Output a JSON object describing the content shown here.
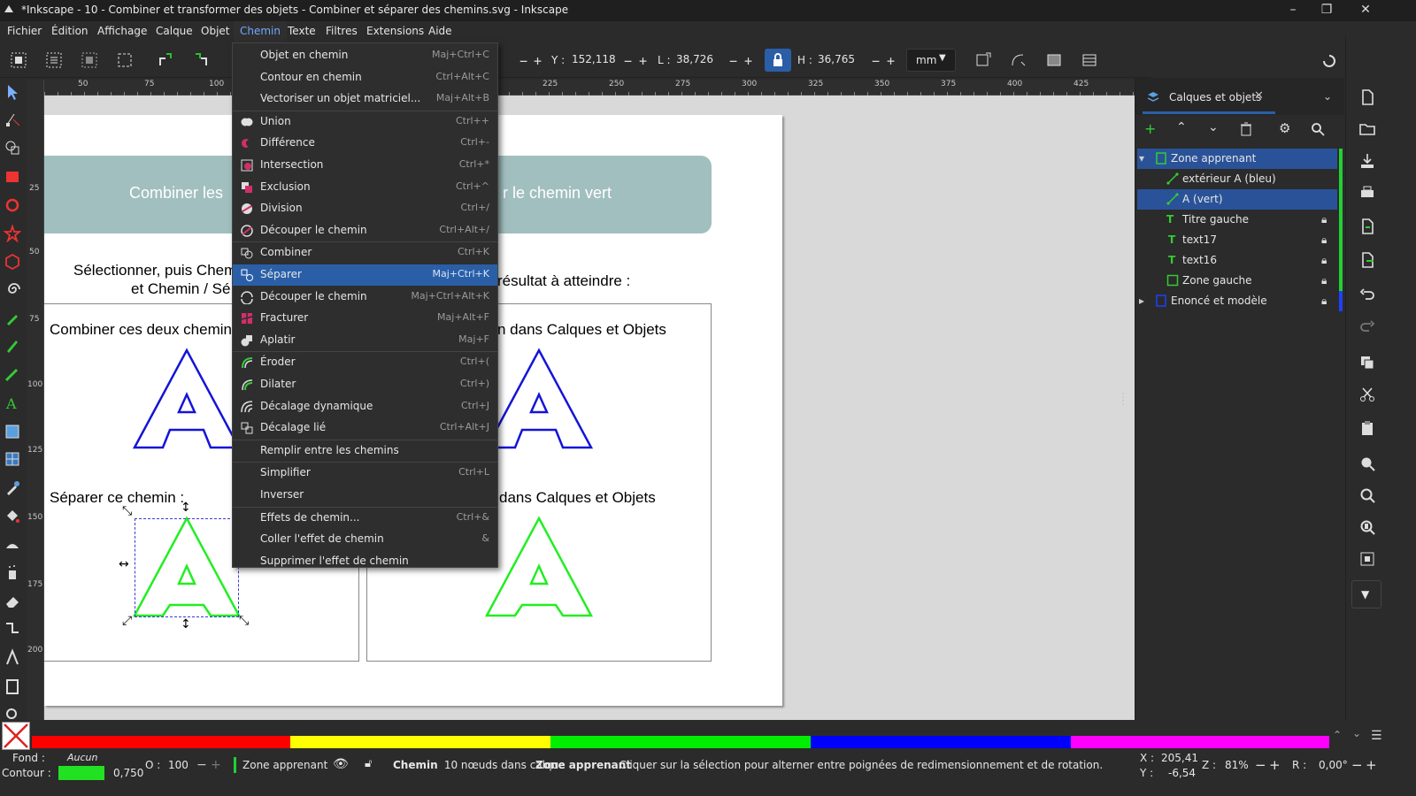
{
  "window": {
    "title": "*Inkscape - 10 - Combiner et transformer des objets - Combiner et séparer des chemins.svg - Inkscape",
    "minimize": "–",
    "maximize": "❐",
    "close": "✕"
  },
  "menubar": [
    "Fichier",
    "Édition",
    "Affichage",
    "Calque",
    "Objet",
    "Chemin",
    "Texte",
    "Filtres",
    "Extensions",
    "Aide"
  ],
  "toolbar": {
    "y_label": "Y :",
    "y_value": "152,118",
    "w_label": "L :",
    "w_value": "38,726",
    "h_label": "H :",
    "h_value": "36,765",
    "unit": "mm",
    "plus": "+",
    "minus": "−"
  },
  "ruler": {
    "h_ticks": [
      "50",
      "75",
      "100",
      "225",
      "250",
      "275",
      "300",
      "325",
      "350",
      "375",
      "400",
      "425"
    ],
    "v_ticks": [
      "25",
      "50",
      "75",
      "100",
      "125",
      "150",
      "175",
      "200"
    ]
  },
  "canvas": {
    "banner_left": "Combiner les",
    "banner_right": "r le chemin vert",
    "instr_line1": "Sélectionner, puis Chem",
    "instr_line2": "et Chemin / Sé",
    "result_label": "résultat à atteindre :",
    "combine_label": "Combiner ces deux chemin",
    "combine_right": "n dans Calques et Objets",
    "separate_label": "Séparer ce chemin :",
    "separate_right": "dans Calques et Objets"
  },
  "chemin_menu": [
    {
      "label": "Objet en chemin",
      "shortcut": "Maj+Ctrl+C",
      "icon": ""
    },
    {
      "label": "Contour en chemin",
      "shortcut": "Ctrl+Alt+C",
      "icon": ""
    },
    {
      "label": "Vectoriser un objet matriciel...",
      "shortcut": "Maj+Alt+B",
      "icon": ""
    },
    {
      "label": "Union",
      "shortcut": "Ctrl++",
      "icon": "union-icon"
    },
    {
      "label": "Différence",
      "shortcut": "Ctrl+-",
      "icon": "difference-icon"
    },
    {
      "label": "Intersection",
      "shortcut": "Ctrl+*",
      "icon": "intersection-icon"
    },
    {
      "label": "Exclusion",
      "shortcut": "Ctrl+^",
      "icon": "exclusion-icon"
    },
    {
      "label": "Division",
      "shortcut": "Ctrl+/",
      "icon": "division-icon"
    },
    {
      "label": "Découper le chemin",
      "shortcut": "Ctrl+Alt+/",
      "icon": "cut-path-icon"
    },
    {
      "label": "Combiner",
      "shortcut": "Ctrl+K",
      "icon": "combine-icon"
    },
    {
      "label": "Séparer",
      "shortcut": "Maj+Ctrl+K",
      "icon": "break-apart-icon"
    },
    {
      "label": "Découper le chemin",
      "shortcut": "Maj+Ctrl+Alt+K",
      "icon": "split-path-icon"
    },
    {
      "label": "Fracturer",
      "shortcut": "Maj+Alt+F",
      "icon": "fracture-icon"
    },
    {
      "label": "Aplatir",
      "shortcut": "Maj+F",
      "icon": "flatten-icon"
    },
    {
      "label": "Éroder",
      "shortcut": "Ctrl+(",
      "icon": "inset-icon"
    },
    {
      "label": "Dilater",
      "shortcut": "Ctrl+)",
      "icon": "outset-icon"
    },
    {
      "label": "Décalage dynamique",
      "shortcut": "Ctrl+J",
      "icon": "dynamic-offset-icon"
    },
    {
      "label": "Décalage lié",
      "shortcut": "Ctrl+Alt+J",
      "icon": "linked-offset-icon"
    },
    {
      "label": "Remplir entre les chemins",
      "shortcut": "",
      "icon": ""
    },
    {
      "label": "Simplifier",
      "shortcut": "Ctrl+L",
      "icon": ""
    },
    {
      "label": "Inverser",
      "shortcut": "",
      "icon": ""
    },
    {
      "label": "Effets de chemin...",
      "shortcut": "Ctrl+&",
      "icon": ""
    },
    {
      "label": "Coller l'effet de chemin",
      "shortcut": "&",
      "icon": ""
    },
    {
      "label": "Supprimer l'effet de chemin",
      "shortcut": "",
      "icon": ""
    }
  ],
  "panel": {
    "tab": "Calques et objets",
    "layers": [
      {
        "label": "Zone apprenant",
        "kind": "layer",
        "bar": "#22d033"
      },
      {
        "label": "extérieur A (bleu)",
        "kind": "path",
        "bar": "#22d033"
      },
      {
        "label": "A (vert)",
        "kind": "path",
        "bar": "#22d033"
      },
      {
        "label": "Titre gauche",
        "kind": "text-frame",
        "bar": "#22d033"
      },
      {
        "label": "text17",
        "kind": "text",
        "bar": "#22d033"
      },
      {
        "label": "text16",
        "kind": "text",
        "bar": "#22d033"
      },
      {
        "label": "Zone gauche",
        "kind": "rect",
        "bar": "#22d033"
      },
      {
        "label": "Enoncé et modèle",
        "kind": "layer",
        "bar": "#1e40ff"
      }
    ]
  },
  "status": {
    "fill_label": "Fond :",
    "fill_value": "Aucun",
    "stroke_label": "Contour :",
    "stroke_width": "0,750",
    "opacity_label": "O :",
    "opacity_value": "100",
    "layer_name": "Zone apprenant",
    "message_bold": "Chemin",
    "message_mid": " 10 nœuds dans calque ",
    "message_layer": "Zone apprenant",
    "message_tail": ". Cliquer sur la sélection pour alterner entre poignées de redimensionnement et de rotation.",
    "x_label": "X :",
    "x_value": "205,41",
    "y_label": "Y :",
    "y_value": "-6,54",
    "zoom_label": "Z :",
    "zoom_value": "81%",
    "rot_label": "R :",
    "rot_value": "0,00°"
  },
  "colors": {
    "accent": "#2a5fa8",
    "fill_swatch": "#22e022",
    "blue_stroke": "#1414d8",
    "green_stroke": "#22ee22",
    "banner": "#a2bfbf"
  },
  "palette": [
    "#ff0000",
    "#ffff00",
    "#00ee00",
    "#0000ff",
    "#ff00ff"
  ]
}
